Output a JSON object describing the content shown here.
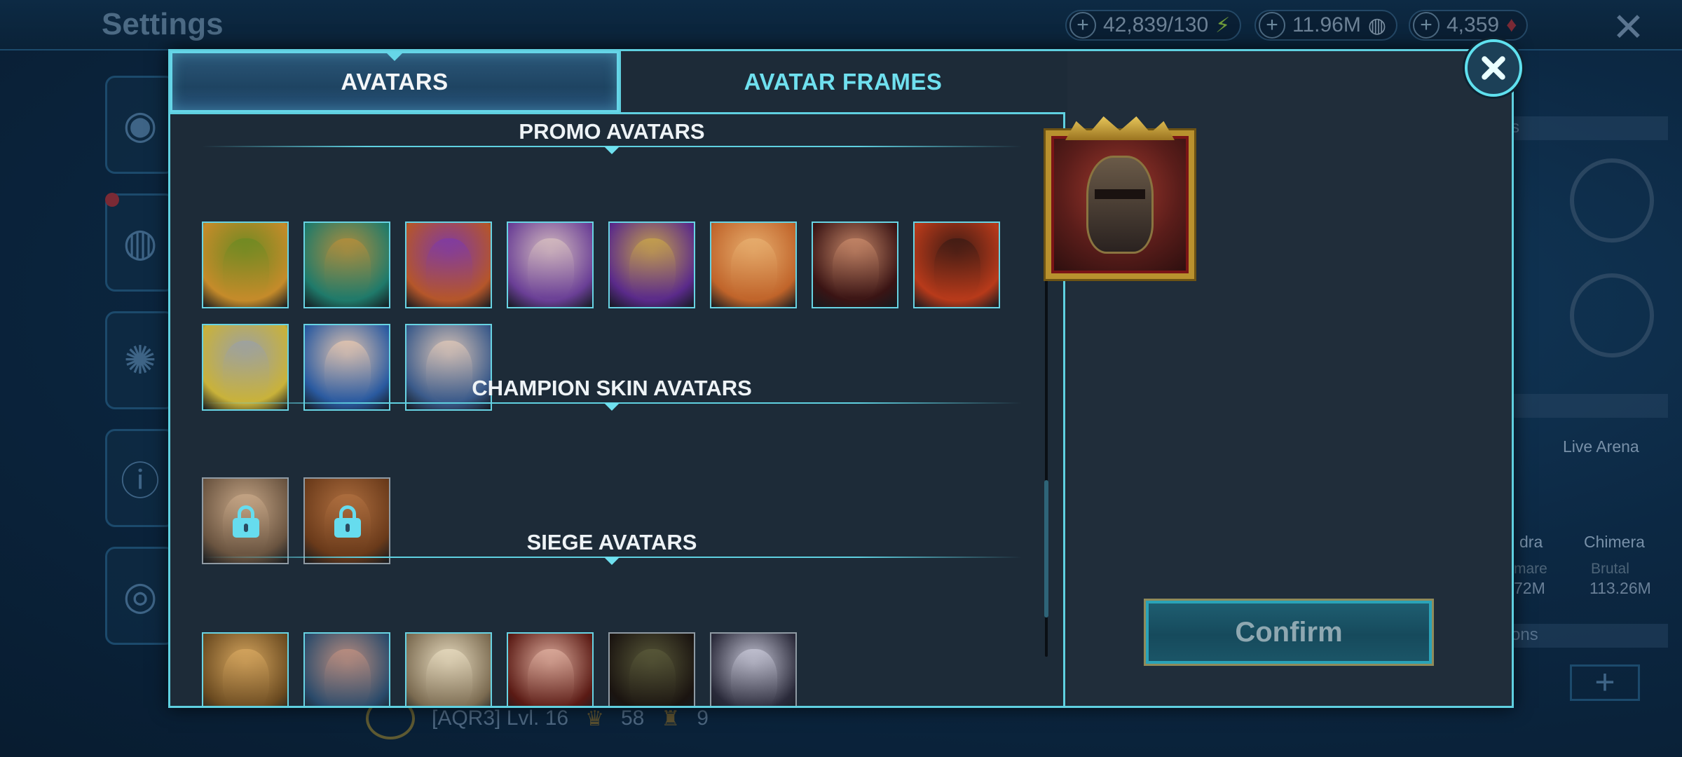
{
  "background": {
    "title": "Settings",
    "resources": [
      {
        "value": "42,839/130",
        "icon": "energy-bolt-icon",
        "glyph": "⚡",
        "color": "#6f9a3a"
      },
      {
        "value": "11.96M",
        "icon": "silver-coin-icon",
        "glyph": "◍",
        "color": "#7a8ea0"
      },
      {
        "value": "4,359",
        "icon": "gem-icon",
        "glyph": "♦",
        "color": "#7a2a35"
      }
    ],
    "right_panel": {
      "live_arena": "Live Arena",
      "hydra": "dra",
      "chimera": "Chimera",
      "nightmare": "mare",
      "brutal": "Brutal",
      "hydra_value": "72M",
      "chimera_value": "113.26M",
      "header_1": "s",
      "header_2": "ons"
    },
    "bottom": {
      "clan": "[AQR3] Lvl. 16",
      "trophies": "58",
      "keys": "9"
    }
  },
  "modal": {
    "tabs": [
      {
        "label": "AVATARS",
        "active": true
      },
      {
        "label": "AVATAR FRAMES",
        "active": false
      }
    ],
    "sections": {
      "promo": {
        "title": "PROMO AVATARS",
        "avatars": [
          {
            "name": "promo-avatar-1",
            "colors": [
              "#c58b2a",
              "#6b8a22"
            ]
          },
          {
            "name": "promo-avatar-2",
            "colors": [
              "#1f7a6a",
              "#b88e3a"
            ]
          },
          {
            "name": "promo-avatar-3",
            "colors": [
              "#b5562a",
              "#7d3aa8"
            ]
          },
          {
            "name": "promo-avatar-4",
            "colors": [
              "#6a3f96",
              "#d8c0c0"
            ]
          },
          {
            "name": "promo-avatar-5",
            "colors": [
              "#5a2a8a",
              "#c9a54a"
            ]
          },
          {
            "name": "promo-avatar-6",
            "colors": [
              "#c0642a",
              "#e8b070"
            ]
          },
          {
            "name": "promo-avatar-7",
            "colors": [
              "#3a1414",
              "#c98a6a"
            ]
          },
          {
            "name": "promo-avatar-8",
            "colors": [
              "#b83a1a",
              "#3a1a14"
            ]
          },
          {
            "name": "promo-avatar-9",
            "colors": [
              "#c9b23a",
              "#9aa0a6"
            ]
          },
          {
            "name": "promo-avatar-10",
            "colors": [
              "#2a5aa0",
              "#e8c8b0"
            ]
          },
          {
            "name": "promo-avatar-11",
            "colors": [
              "#3a5a8a",
              "#e0c8b8"
            ]
          }
        ]
      },
      "champion_skin": {
        "title": "CHAMPION SKIN AVATARS",
        "avatars": [
          {
            "name": "skin-avatar-1",
            "locked": true,
            "colors": [
              "#6a5440",
              "#c8a888"
            ]
          },
          {
            "name": "skin-avatar-2",
            "locked": true,
            "colors": [
              "#6a3a1a",
              "#b07040"
            ]
          }
        ]
      },
      "siege": {
        "title": "SIEGE AVATARS",
        "avatars": [
          {
            "name": "siege-avatar-1",
            "colors": [
              "#6a4a20",
              "#d8a860"
            ]
          },
          {
            "name": "siege-avatar-2",
            "colors": [
              "#2a4a6a",
              "#c09080"
            ]
          },
          {
            "name": "siege-avatar-3",
            "colors": [
              "#7a6a50",
              "#e8dcc0"
            ]
          },
          {
            "name": "siege-avatar-4",
            "colors": [
              "#5a1a14",
              "#e0b0a0"
            ]
          },
          {
            "name": "siege-avatar-5",
            "colors": [
              "#1a1410",
              "#5a5a3a"
            ]
          },
          {
            "name": "siege-avatar-6",
            "colors": [
              "#2a2a3a",
              "#c8c8d8"
            ]
          }
        ]
      }
    },
    "confirm_label": "Confirm",
    "selected_preview": "selected-avatar-preview"
  }
}
